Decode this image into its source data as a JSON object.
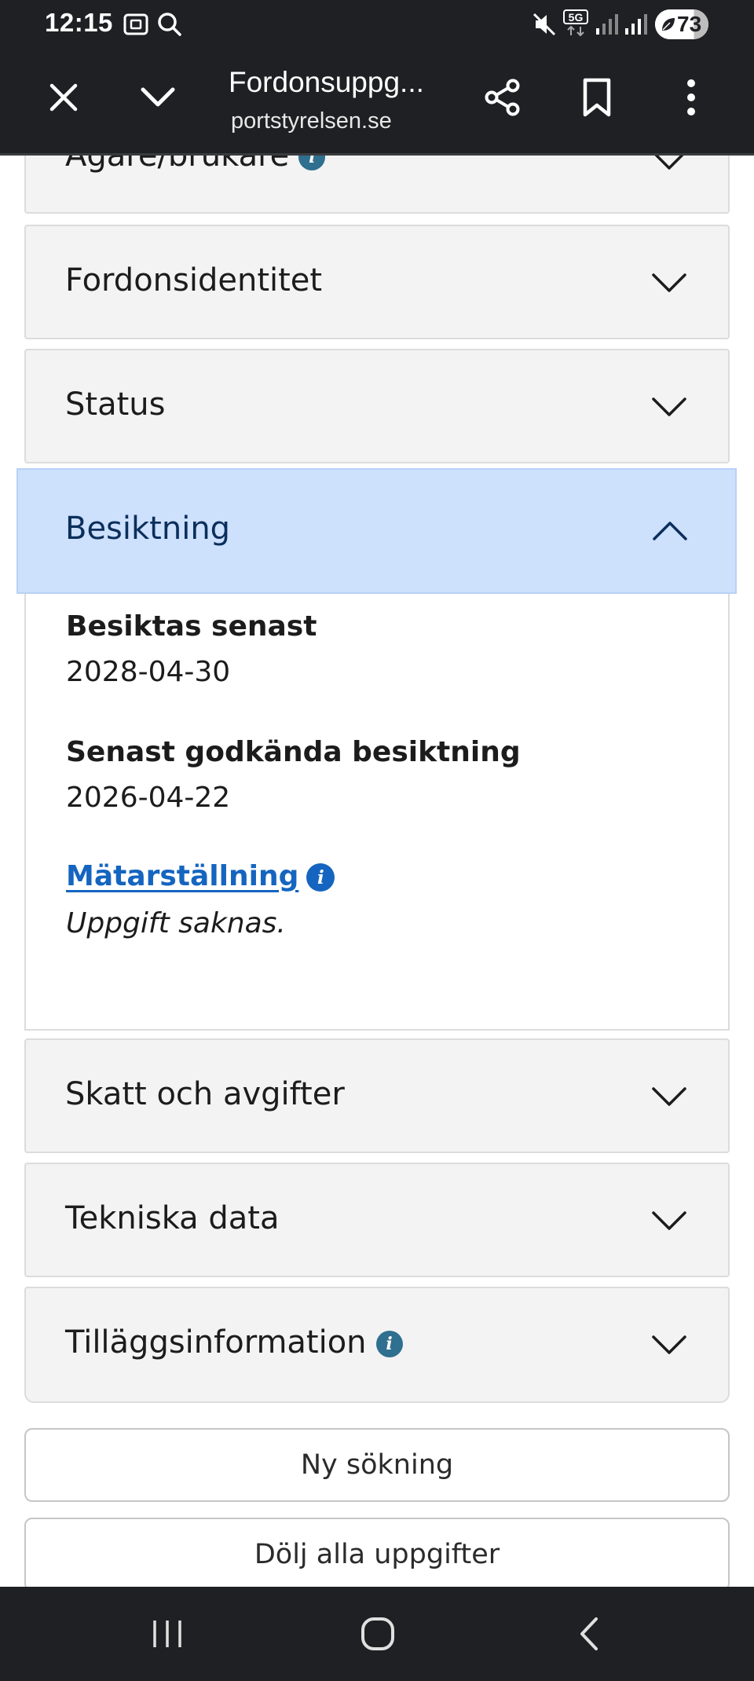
{
  "status_bar": {
    "time": "12:15",
    "network": "5G",
    "battery": 73,
    "battery_label": "73"
  },
  "browser": {
    "title": "Fordonsuppg...",
    "url": "portstyrelsen.se"
  },
  "accordion": {
    "sections": [
      {
        "title": "Ägare/brukare",
        "expanded": false,
        "has_info": true
      },
      {
        "title": "Fordonsidentitet",
        "expanded": false
      },
      {
        "title": "Status",
        "expanded": false
      },
      {
        "title": "Besiktning",
        "expanded": true
      },
      {
        "title": "Skatt och avgifter",
        "expanded": false
      },
      {
        "title": "Tekniska data",
        "expanded": false
      },
      {
        "title": "Tilläggsinformation",
        "expanded": false,
        "has_info": true
      }
    ],
    "besiktning": {
      "fields": [
        {
          "label": "Besiktas senast",
          "value": "2028-04-30"
        },
        {
          "label": "Senast godkända besiktning",
          "value": "2026-04-22"
        }
      ],
      "meter_link": "Mätarställning",
      "meter_value": "Uppgift saknas."
    }
  },
  "actions": {
    "new_search": "Ny sökning",
    "hide_all": "Dölj alla uppgifter"
  },
  "icons": {
    "info": "i"
  },
  "colors": {
    "system_bar": "#1f2023",
    "accordion_bg": "#f3f3f3",
    "expanded_header": "#cde0fc",
    "expanded_title": "#0b2f5c",
    "link": "#1565c0"
  }
}
